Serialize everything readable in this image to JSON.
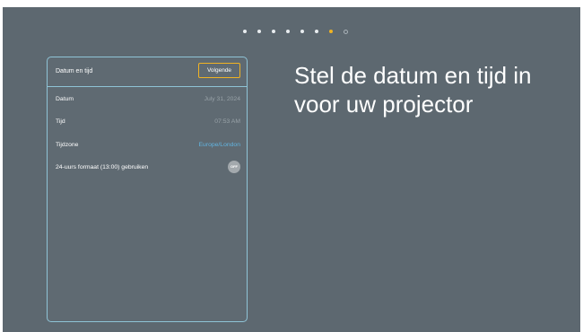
{
  "progress": {
    "total_steps": 8,
    "current_step": 7
  },
  "panel": {
    "title": "Datum en tijd",
    "next_button": "Volgende",
    "rows": [
      {
        "label": "Datum",
        "value": "July 31, 2024"
      },
      {
        "label": "Tijd",
        "value": "07:53 AM"
      },
      {
        "label": "Tijdzone",
        "value": "Europe/London"
      },
      {
        "label": "24-uurs formaat (13:00) gebruiken",
        "toggle": "OFF"
      }
    ]
  },
  "heading": {
    "line1": "Stel de datum en tijd in",
    "line2": "voor uw projector"
  },
  "colors": {
    "background": "#5d6870",
    "accent": "#f0b323",
    "panel_border": "#8ec3d6",
    "link": "#62b4e0"
  }
}
